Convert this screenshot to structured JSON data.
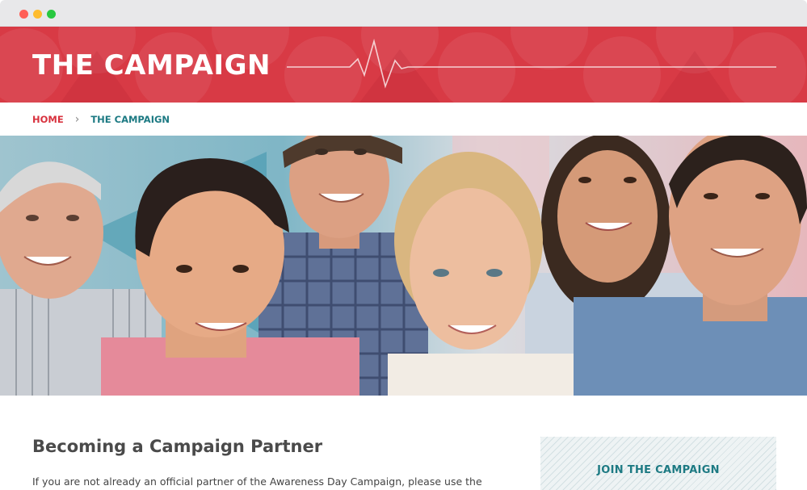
{
  "window": {
    "controls": [
      "close",
      "minimize",
      "zoom"
    ]
  },
  "banner": {
    "title": "THE CAMPAIGN",
    "decoration": "heartbeat-line",
    "background_color": "#d83a45"
  },
  "breadcrumb": {
    "items": [
      {
        "label": "HOME",
        "color": "#d8323e"
      },
      {
        "label": "THE CAMPAIGN",
        "color": "#1d7a83"
      }
    ],
    "separator_icon": "chevron-right-icon"
  },
  "hero": {
    "image": "group-of-smiling-people-photo"
  },
  "main": {
    "heading": "Becoming a Campaign Partner",
    "paragraph": "If you are not already an official partner of the Awareness Day Campaign, please use the"
  },
  "sidebar": {
    "join_label": "JOIN THE CAMPAIGN",
    "accent_color": "#1d7a83"
  }
}
